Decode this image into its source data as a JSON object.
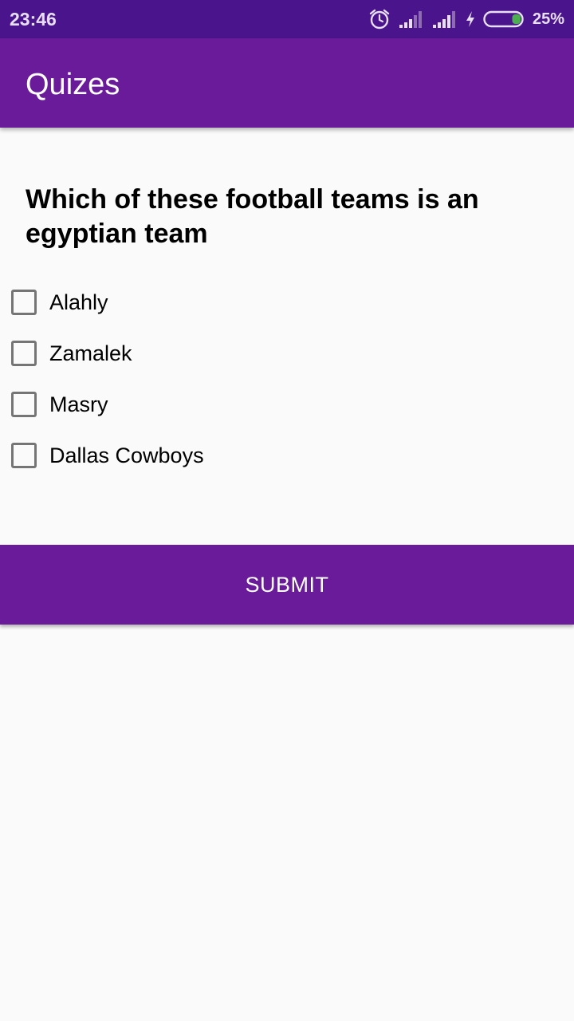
{
  "status_bar": {
    "time": "23:46",
    "battery_percent": "25%",
    "icons": [
      "alarm-icon",
      "signal-icon",
      "signal-icon",
      "charging-icon",
      "battery-icon"
    ],
    "battery_level": 0.25,
    "battery_color": "#4CAF50"
  },
  "app_bar": {
    "title": "Quizes",
    "color": "#6A1B9A"
  },
  "question": {
    "text": "Which of these football teams is an egyptian team"
  },
  "options": [
    {
      "label": "Alahly",
      "checked": false
    },
    {
      "label": "Zamalek",
      "checked": false
    },
    {
      "label": "Masry",
      "checked": false
    },
    {
      "label": "Dallas Cowboys",
      "checked": false
    }
  ],
  "submit": {
    "label": "SUBMIT"
  }
}
